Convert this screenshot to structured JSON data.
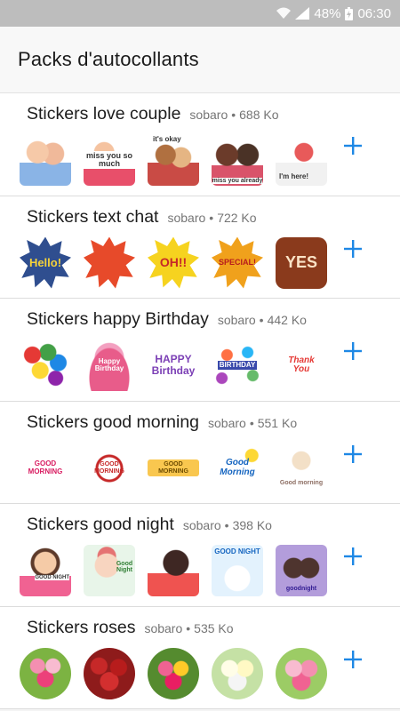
{
  "status_bar": {
    "battery": "48%",
    "time": "06:30"
  },
  "app_bar": {
    "title": "Packs d'autocollants"
  },
  "packs": [
    {
      "name": "Stickers love couple",
      "publisher": "sobaro",
      "size": "688 Ko",
      "stickers": [
        "",
        "miss you so much",
        "it's okay",
        "miss you already",
        "I'm here!"
      ]
    },
    {
      "name": "Stickers text chat",
      "publisher": "sobaro",
      "size": "722 Ko",
      "stickers": [
        "Hello!",
        "",
        "OH!!",
        "SPECIAL!",
        "YES"
      ]
    },
    {
      "name": "Stickers happy Birthday",
      "publisher": "sobaro",
      "size": "442 Ko",
      "stickers": [
        "",
        "Happy Birthday",
        "HAPPY Birthday",
        "BIRTHDAY",
        "Thank You"
      ]
    },
    {
      "name": "Stickers good morning",
      "publisher": "sobaro",
      "size": "551 Ko",
      "stickers": [
        "GOOD MORNING",
        "GOOD MORNING",
        "GOOD MORNING",
        "Good Morning",
        "Good morning"
      ]
    },
    {
      "name": "Stickers good night",
      "publisher": "sobaro",
      "size": "398 Ko",
      "stickers": [
        "GOOD NIGHT",
        "Good Night",
        "",
        "GOOD NIGHT",
        "goodnight"
      ]
    },
    {
      "name": "Stickers roses",
      "publisher": "sobaro",
      "size": "535 Ko",
      "stickers": [
        "",
        "",
        "",
        "",
        ""
      ]
    }
  ],
  "colors": {
    "accent": "#1e88e5",
    "status_bar": "#bdbdbd"
  },
  "icons": {
    "add": "plus-icon",
    "wifi": "wifi-icon",
    "signal": "signal-icon",
    "battery": "battery-icon"
  }
}
